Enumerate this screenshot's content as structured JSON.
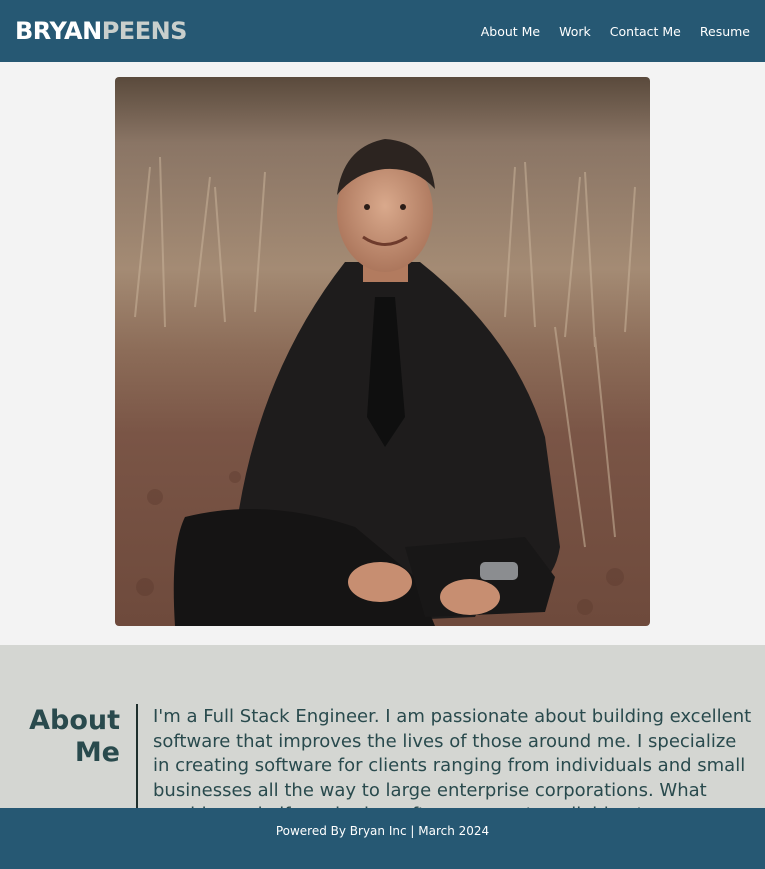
{
  "header": {
    "logo_part1": "BRYAN",
    "logo_part2": "PEENS",
    "nav": [
      {
        "label": "About Me"
      },
      {
        "label": "Work"
      },
      {
        "label": "Contact Me"
      },
      {
        "label": "Resume"
      }
    ]
  },
  "colors": {
    "header_bg": "#265873",
    "page_bg": "#f3f3f3",
    "about_bg": "#d4d6d2",
    "heading_text": "#294a4d"
  },
  "about": {
    "title_line1": "About",
    "title_line2": "Me",
    "text": "I'm a Full Stack Engineer. I am passionate about building excellent software that improves the lives of those around me. I specialize in creating software for clients ranging from individuals and small businesses all the way to large enterprise corporations. What would you do if you had a software expert available at your fingertips?"
  },
  "footer": {
    "text": "Powered By Bryan Inc | March 2024"
  }
}
